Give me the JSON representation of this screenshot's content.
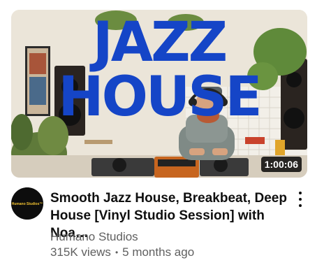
{
  "thumbnail": {
    "headline_top": "JAZZ",
    "headline_bottom": "HOUSE",
    "duration": "1:00:06",
    "accent_color": "#1545c7"
  },
  "avatar": {
    "label": "Humano Studios™"
  },
  "video": {
    "title": "Smooth Jazz House, Breakbeat, Deep House [Vinyl Studio Session] with Noa…",
    "channel": "Humano Studios",
    "views": "315K views",
    "separator": "•",
    "age": "5 months ago"
  },
  "icons": {
    "menu": "more-vert-icon"
  }
}
